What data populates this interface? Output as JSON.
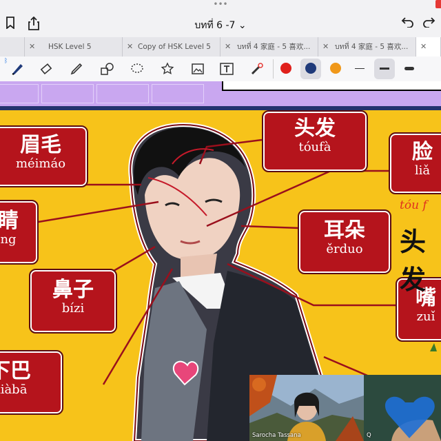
{
  "nav": {
    "title": "บทที่ 6 -7 ⌄"
  },
  "tabs": [
    {
      "label": ""
    },
    {
      "label": "HSK Level 5"
    },
    {
      "label": "Copy of HSK Level 5"
    },
    {
      "label": "บทที่ 4 家庭 - 5 喜欢..."
    },
    {
      "label": "บทที่ 4 家庭 - 5 喜欢..."
    }
  ],
  "toolbar": {
    "tools": [
      "pen-tool",
      "eraser-tool",
      "highlighter-tool",
      "shapes-tool",
      "lasso-tool",
      "sticker-tool",
      "image-tool",
      "text-tool",
      "laser-tool"
    ],
    "colors": [
      "#e0201c",
      "#1f3a7a",
      "#f0981a"
    ]
  },
  "slide": {
    "cards": [
      {
        "zh": "眉毛",
        "py": "méimáo"
      },
      {
        "zh": "头发",
        "py": "tóufà"
      },
      {
        "zh": "脸",
        "py": "liǎ"
      },
      {
        "zh": "睛",
        "py": "ng"
      },
      {
        "zh": "耳朵",
        "py": "ěrduo"
      },
      {
        "zh": "鼻子",
        "py": "bízi"
      },
      {
        "zh": "嘴",
        "py": "zuǐ"
      },
      {
        "zh": "下巴",
        "py": "xiàbā"
      }
    ],
    "handwriting": "tóu f",
    "big_text": "头发"
  },
  "video": {
    "p1_name": "Sarocha Tassana",
    "p2_name": "Q"
  }
}
